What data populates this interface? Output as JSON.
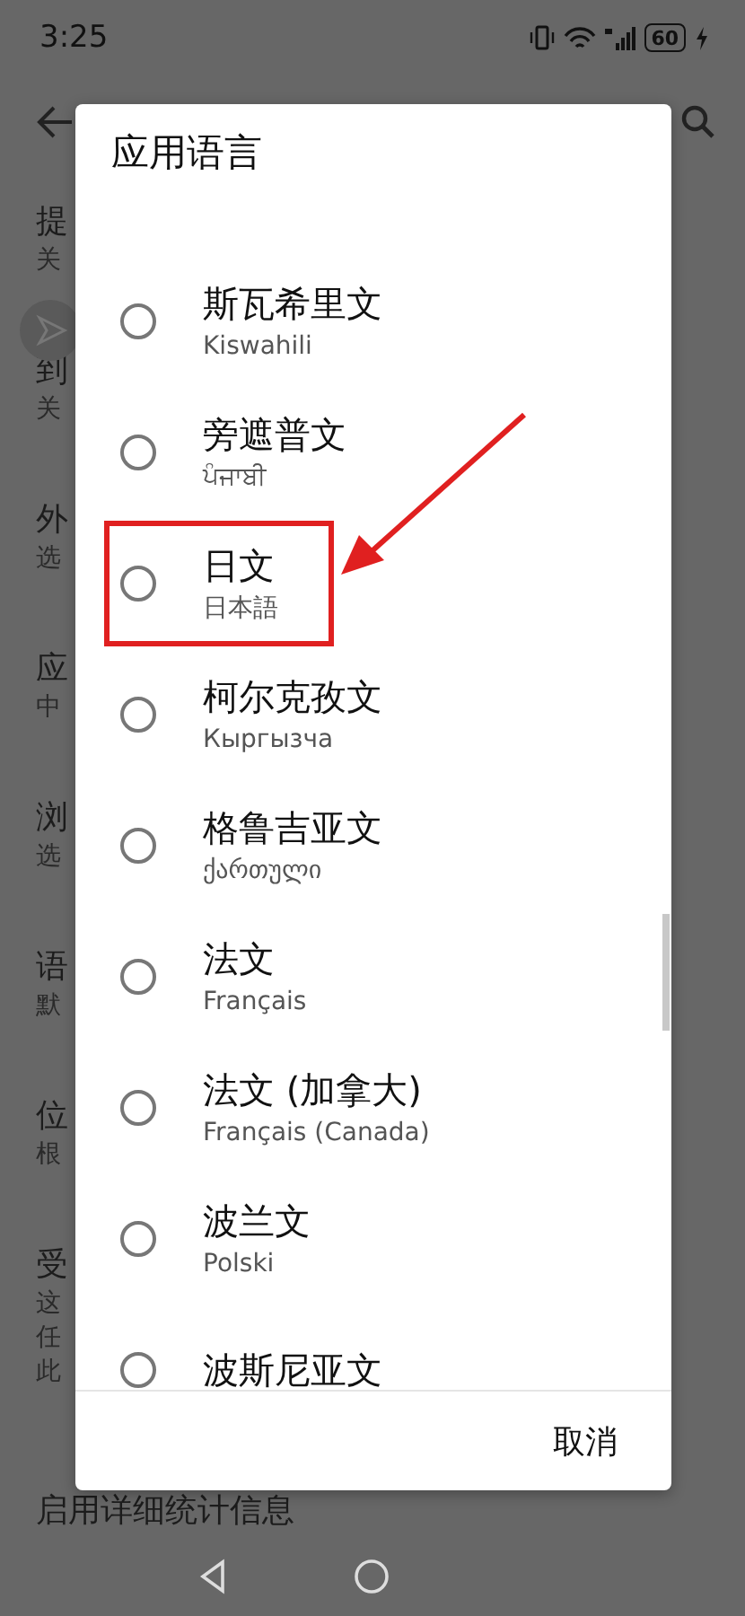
{
  "status_bar": {
    "time": "3:25",
    "battery": "60"
  },
  "background": {
    "items": [
      {
        "title": "提",
        "subtitle": [
          "关"
        ]
      },
      {
        "title": "到",
        "subtitle": [
          "关"
        ]
      },
      {
        "title": "外",
        "subtitle": [
          "选"
        ]
      },
      {
        "title": "应",
        "subtitle": [
          "中"
        ]
      },
      {
        "title": "浏",
        "subtitle": [
          "选"
        ]
      },
      {
        "title": "语",
        "subtitle": [
          "默"
        ]
      },
      {
        "title": "位",
        "subtitle": [
          "根"
        ]
      },
      {
        "title": "受",
        "subtitle": [
          "这",
          "任",
          "此"
        ]
      }
    ],
    "last_item": "启用详细统计信息"
  },
  "dialog": {
    "title": "应用语言",
    "options": [
      {
        "label": "斯瓦希里文",
        "native": "Kiswahili",
        "selected": false,
        "annotated": false
      },
      {
        "label": "旁遮普文",
        "native": "ਪੰਜਾਬੀ",
        "selected": false,
        "annotated": false
      },
      {
        "label": "日文",
        "native": "日本語",
        "selected": false,
        "annotated": true
      },
      {
        "label": "柯尔克孜文",
        "native": "Кыргызча",
        "selected": false,
        "annotated": false
      },
      {
        "label": "格鲁吉亚文",
        "native": "ქართული",
        "selected": false,
        "annotated": false
      },
      {
        "label": "法文",
        "native": "Français",
        "selected": false,
        "annotated": false
      },
      {
        "label": "法文 (加拿大)",
        "native": "Français (Canada)",
        "selected": false,
        "annotated": false
      },
      {
        "label": "波兰文",
        "native": "Polski",
        "selected": false,
        "annotated": false
      },
      {
        "label": "波斯尼亚文",
        "selected": false,
        "annotated": false
      }
    ],
    "cancel": "取消"
  }
}
